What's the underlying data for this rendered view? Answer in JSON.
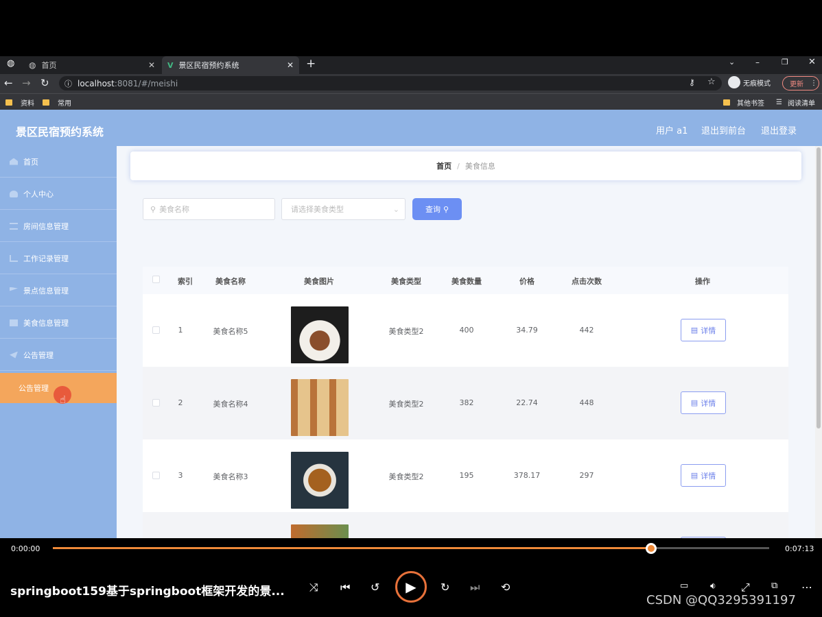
{
  "browser": {
    "tabs": [
      {
        "label": "首页"
      },
      {
        "label": "景区民宿预约系统"
      }
    ],
    "address": {
      "host": "localhost",
      "path": ":8081/#/meishi"
    },
    "incognito": "无痕模式",
    "update": "更新",
    "bookmarks": [
      "资料",
      "常用"
    ],
    "bookmarks_right": [
      "其他书签",
      "阅读清单"
    ]
  },
  "app": {
    "brand": "景区民宿预约系统",
    "top_links": [
      "用户 a1",
      "退出到前台",
      "退出登录"
    ],
    "menu": [
      "首页",
      "个人中心",
      "房间信息管理",
      "工作记录管理",
      "景点信息管理",
      "美食信息管理",
      "公告管理"
    ],
    "submenu": "公告管理",
    "breadcrumb": {
      "home": "首页",
      "sep": "/",
      "current": "美食信息"
    },
    "search": {
      "name_placeholder": "美食名称",
      "type_placeholder": "请选择美食类型",
      "query": "查询"
    },
    "table": {
      "headers": [
        "索引",
        "美食名称",
        "美食图片",
        "美食类型",
        "美食数量",
        "价格",
        "点击次数",
        "操作"
      ],
      "rows": [
        {
          "index": "1",
          "name": "美食名称5",
          "type": "美食类型2",
          "qty": "400",
          "price": "34.79",
          "clicks": "442",
          "action": "详情"
        },
        {
          "index": "2",
          "name": "美食名称4",
          "type": "美食类型2",
          "qty": "382",
          "price": "22.74",
          "clicks": "448",
          "action": "详情"
        },
        {
          "index": "3",
          "name": "美食名称3",
          "type": "美食类型2",
          "qty": "195",
          "price": "378.17",
          "clicks": "297",
          "action": "详情"
        }
      ]
    }
  },
  "player": {
    "current_time": "0:00:00",
    "duration": "0:07:13",
    "progress": 0.835,
    "title": "springboot159基于springboot框架开发的景...",
    "watermark": "CSDN @QQ3295391197",
    "accent": "#f08a38"
  }
}
